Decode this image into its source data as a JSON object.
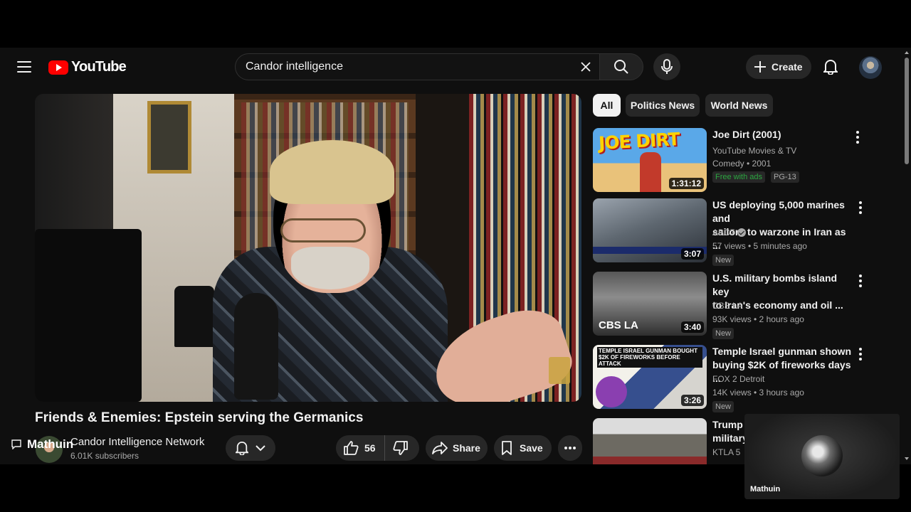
{
  "header": {
    "logo_text": "YouTube",
    "search_value": "Candor intelligence",
    "create_label": "Create"
  },
  "video": {
    "title": "Friends & Enemies: Epstein serving the Germanics",
    "channel_name": "Candor Intelligence Network",
    "subscribers": "6.01K subscribers",
    "likes": "56",
    "share_label": "Share",
    "save_label": "Save",
    "overlay_name": "Mathuin"
  },
  "chips": [
    "All",
    "Politics News",
    "World News"
  ],
  "recommendations": [
    {
      "title_line1": "Joe Dirt (2001)",
      "title_line2": "",
      "channel": "YouTube Movies & TV",
      "meta": "Comedy • 2001",
      "duration": "1:31:12",
      "free_badge": "Free with ads",
      "rating": "PG-13",
      "thumb_text": "JOE DIRT"
    },
    {
      "title_line1": "US deploying 5,000 marines and",
      "title_line2": "sailors to warzone in Iran as ...",
      "channel": "ABC7",
      "meta": "57 views • 5 minutes ago",
      "duration": "3:07",
      "badge": "New"
    },
    {
      "title_line1": "U.S. military bombs island key",
      "title_line2": "to Iran's economy and oil ...",
      "channel": "CBS LA",
      "meta": "93K views • 2 hours ago",
      "duration": "3:40",
      "badge": "New",
      "thumb_text": "CBS LA"
    },
    {
      "title_line1": "Temple Israel gunman shown",
      "title_line2": "buying $2K of fireworks days ...",
      "channel": "FOX 2 Detroit",
      "meta": "14K views • 3 hours ago",
      "duration": "3:26",
      "badge": "New",
      "thumb_text": "TEMPLE ISRAEL GUNMAN BOUGHT $2K OF FIREWORKS BEFORE ATTACK"
    },
    {
      "title_line1": "Trump s",
      "title_line2": "military",
      "channel": "KTLA 5"
    }
  ],
  "pip": {
    "name": "Mathuin"
  },
  "colors": {
    "brand_red": "#ff0000",
    "background": "#0f0f0f",
    "chip_bg": "#272727",
    "free_green": "#2ba640"
  }
}
